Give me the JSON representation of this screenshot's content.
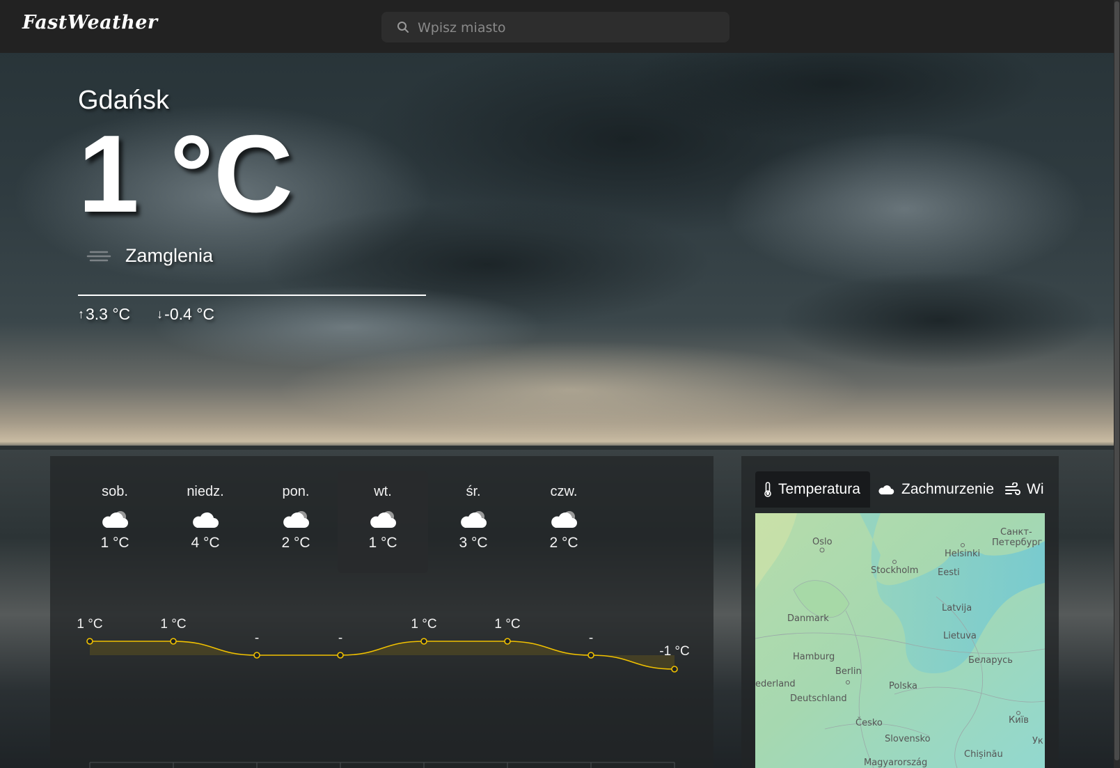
{
  "header": {
    "logo": "FastWeather",
    "search_placeholder": "Wpisz miasto",
    "search_icon": "search-icon"
  },
  "current": {
    "city": "Gdańsk",
    "temperature": "1 °C",
    "description": "Zamglenia",
    "description_icon": "mist-icon",
    "max": "3.3 °C",
    "min": "-0.4 °C"
  },
  "forecast": {
    "days": [
      {
        "name": "sob.",
        "temp": "1 °C",
        "icon": "cloud-icon"
      },
      {
        "name": "niedz.",
        "temp": "4 °C",
        "icon": "cloud-icon"
      },
      {
        "name": "pon.",
        "temp": "2 °C",
        "icon": "cloud-icon"
      },
      {
        "name": "wt.",
        "temp": "1 °C",
        "icon": "cloud-icon",
        "selected": true
      },
      {
        "name": "śr.",
        "temp": "3 °C",
        "icon": "cloud-icon"
      },
      {
        "name": "czw.",
        "temp": "2 °C",
        "icon": "cloud-icon"
      }
    ]
  },
  "chart_data": {
    "type": "area",
    "title": "",
    "xlabel": "",
    "ylabel": "",
    "labels": [
      "1 °C",
      "1 °C",
      "-",
      "-",
      "1 °C",
      "1 °C",
      "-",
      "-1 °C"
    ],
    "values": [
      1,
      1,
      0,
      0,
      1,
      1,
      0,
      -1
    ],
    "ylim": [
      -1,
      1
    ],
    "line_color": "#f2c200",
    "grid": false
  },
  "map": {
    "tabs": [
      {
        "label": "Temperatura",
        "icon": "thermometer-icon",
        "active": true
      },
      {
        "label": "Zachmurzenie",
        "icon": "cloud-icon"
      },
      {
        "label": "Wi",
        "icon": "wind-icon"
      }
    ],
    "places": [
      "Oslo",
      "Санкт-",
      "Петербург",
      "Helsinki",
      "Stockholm",
      "Eesti",
      "Latvija",
      "Danmark",
      "Lietuva",
      "Hamburg",
      "Беларусь",
      "Berlin",
      "ederland",
      "Polska",
      "Deutschland",
      "Київ",
      "Česko",
      "Slovensko",
      "Chișinău",
      "Ук",
      "Magyarország"
    ]
  }
}
